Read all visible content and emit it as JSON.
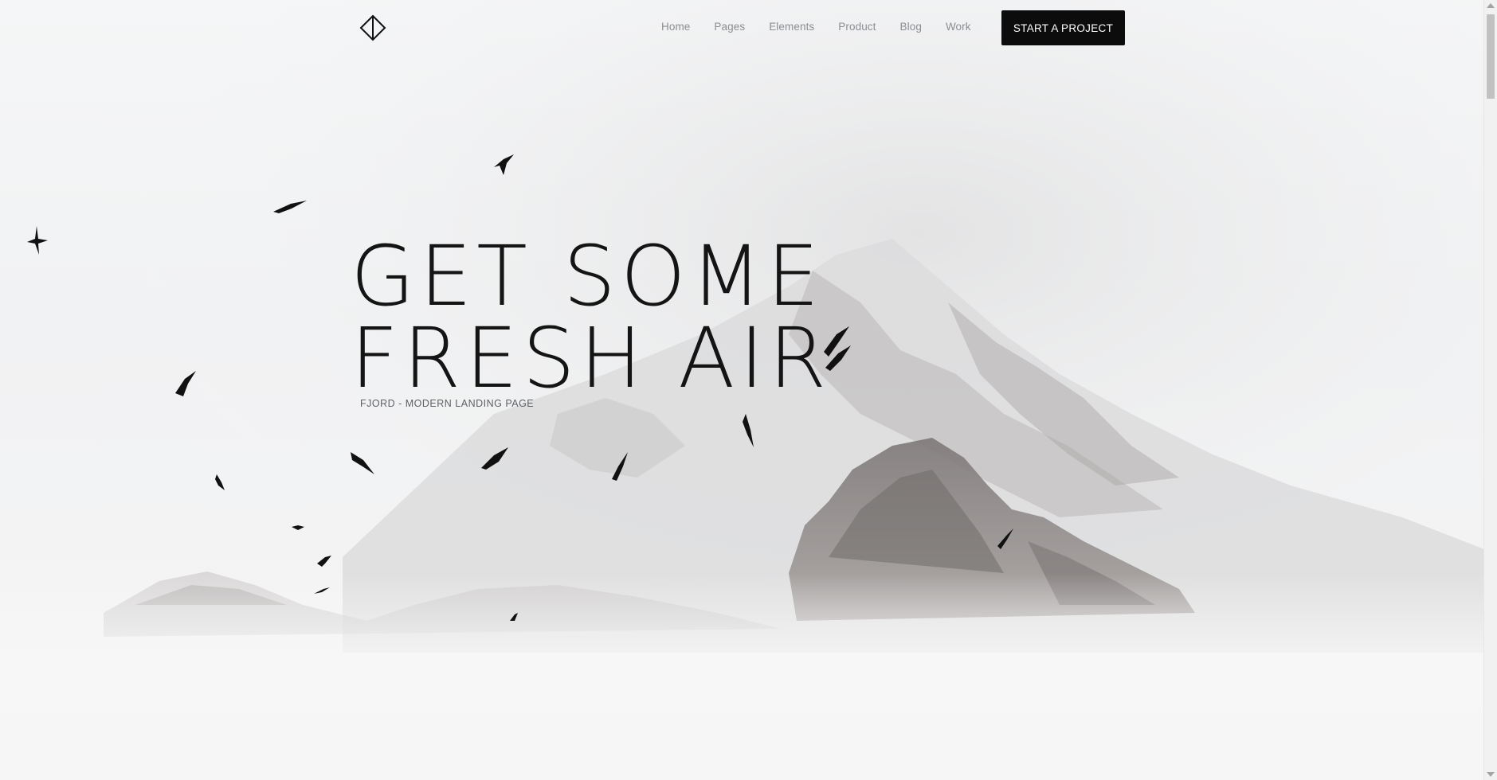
{
  "nav": {
    "logo_icon": "diamond-logo-icon",
    "items": [
      {
        "label": "Home"
      },
      {
        "label": "Pages"
      },
      {
        "label": "Elements"
      },
      {
        "label": "Product"
      },
      {
        "label": "Blog"
      },
      {
        "label": "Work"
      }
    ],
    "cta_label": "START A PROJECT"
  },
  "hero": {
    "headline_line1": "GET SOME",
    "headline_line2": "FRESH AIR",
    "subtitle": "FJORD - MODERN LANDING PAGE",
    "background": "snowy-mountain-with-birds"
  },
  "colors": {
    "accent": "#0c0c0c",
    "nav_text": "#8b8e92",
    "background": "#f4f5f6"
  }
}
